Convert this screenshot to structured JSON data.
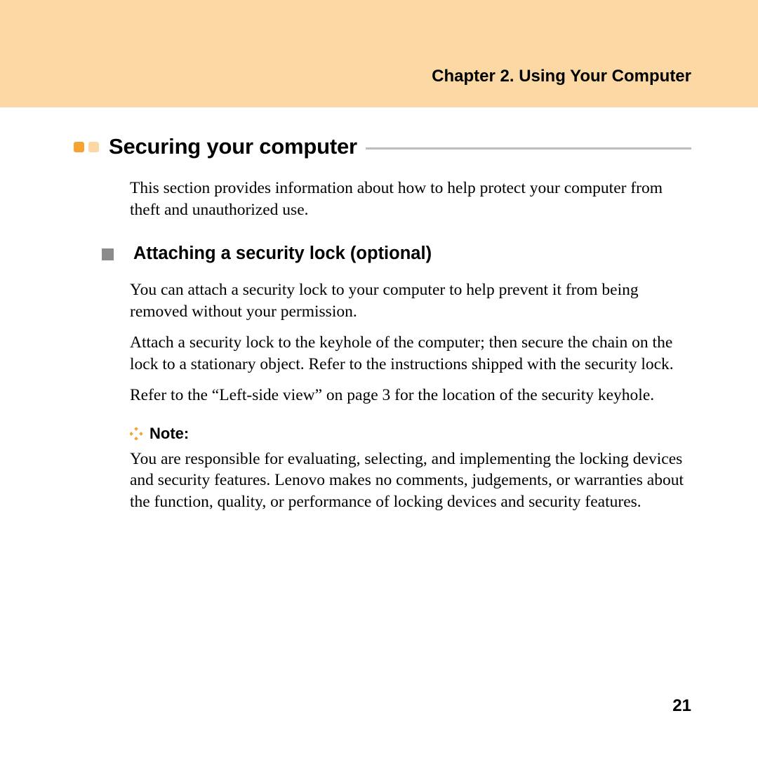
{
  "header": {
    "chapter": "Chapter 2. Using Your Computer"
  },
  "section": {
    "title": "Securing your computer",
    "intro": "This section provides information about how to help protect your computer from theft and unauthorized use."
  },
  "subsection": {
    "title": "Attaching a security lock (optional)",
    "paragraphs": [
      "You can attach a security lock to your computer to help prevent it from being removed without your permission.",
      "Attach a security lock to the keyhole of the computer; then secure the chain on the lock to a stationary object. Refer to the instructions shipped with the security lock.",
      "Refer to the “Left-side view” on page 3 for the location of the security keyhole."
    ]
  },
  "note": {
    "label": "Note:",
    "body": "You are responsible for evaluating, selecting, and implementing the locking devices and security features. Lenovo makes no comments, judgements, or warranties about the function, quality, or performance of locking devices and security features."
  },
  "page_number": "21"
}
